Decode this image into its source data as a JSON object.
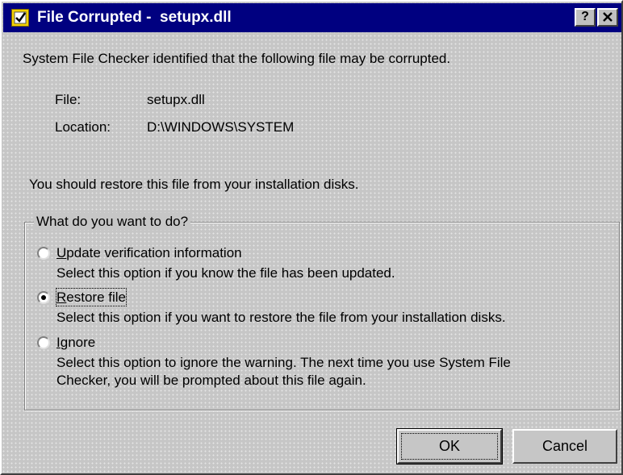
{
  "window": {
    "title": "File Corrupted -  setupx.dll",
    "title_icon": "warning-document-icon",
    "help_button": "?",
    "close_button": "✕"
  },
  "message": "System File Checker identified that the following file may be corrupted.",
  "details": {
    "file_label": "File:",
    "file_value": "setupx.dll",
    "location_label": "Location:",
    "location_value": "D:\\WINDOWS\\SYSTEM"
  },
  "advice": "You should restore this file from your installation disks.",
  "options_group": {
    "label": "What do you want to do?",
    "selected": "restore",
    "options": [
      {
        "id": "update",
        "label": "Update verification information",
        "description": "Select this option if you know the file has been updated."
      },
      {
        "id": "restore",
        "label": "Restore file",
        "description": "Select this option if you want to restore the file from your installation disks."
      },
      {
        "id": "ignore",
        "label": "Ignore",
        "description_line1": "Select this option to ignore the warning. The next time you use System File",
        "description_line2": "Checker, you will be prompted about this file again."
      }
    ]
  },
  "buttons": {
    "ok": "OK",
    "cancel": "Cancel"
  },
  "colors": {
    "titlebar": "#000080",
    "face": "#c6c6c6"
  }
}
